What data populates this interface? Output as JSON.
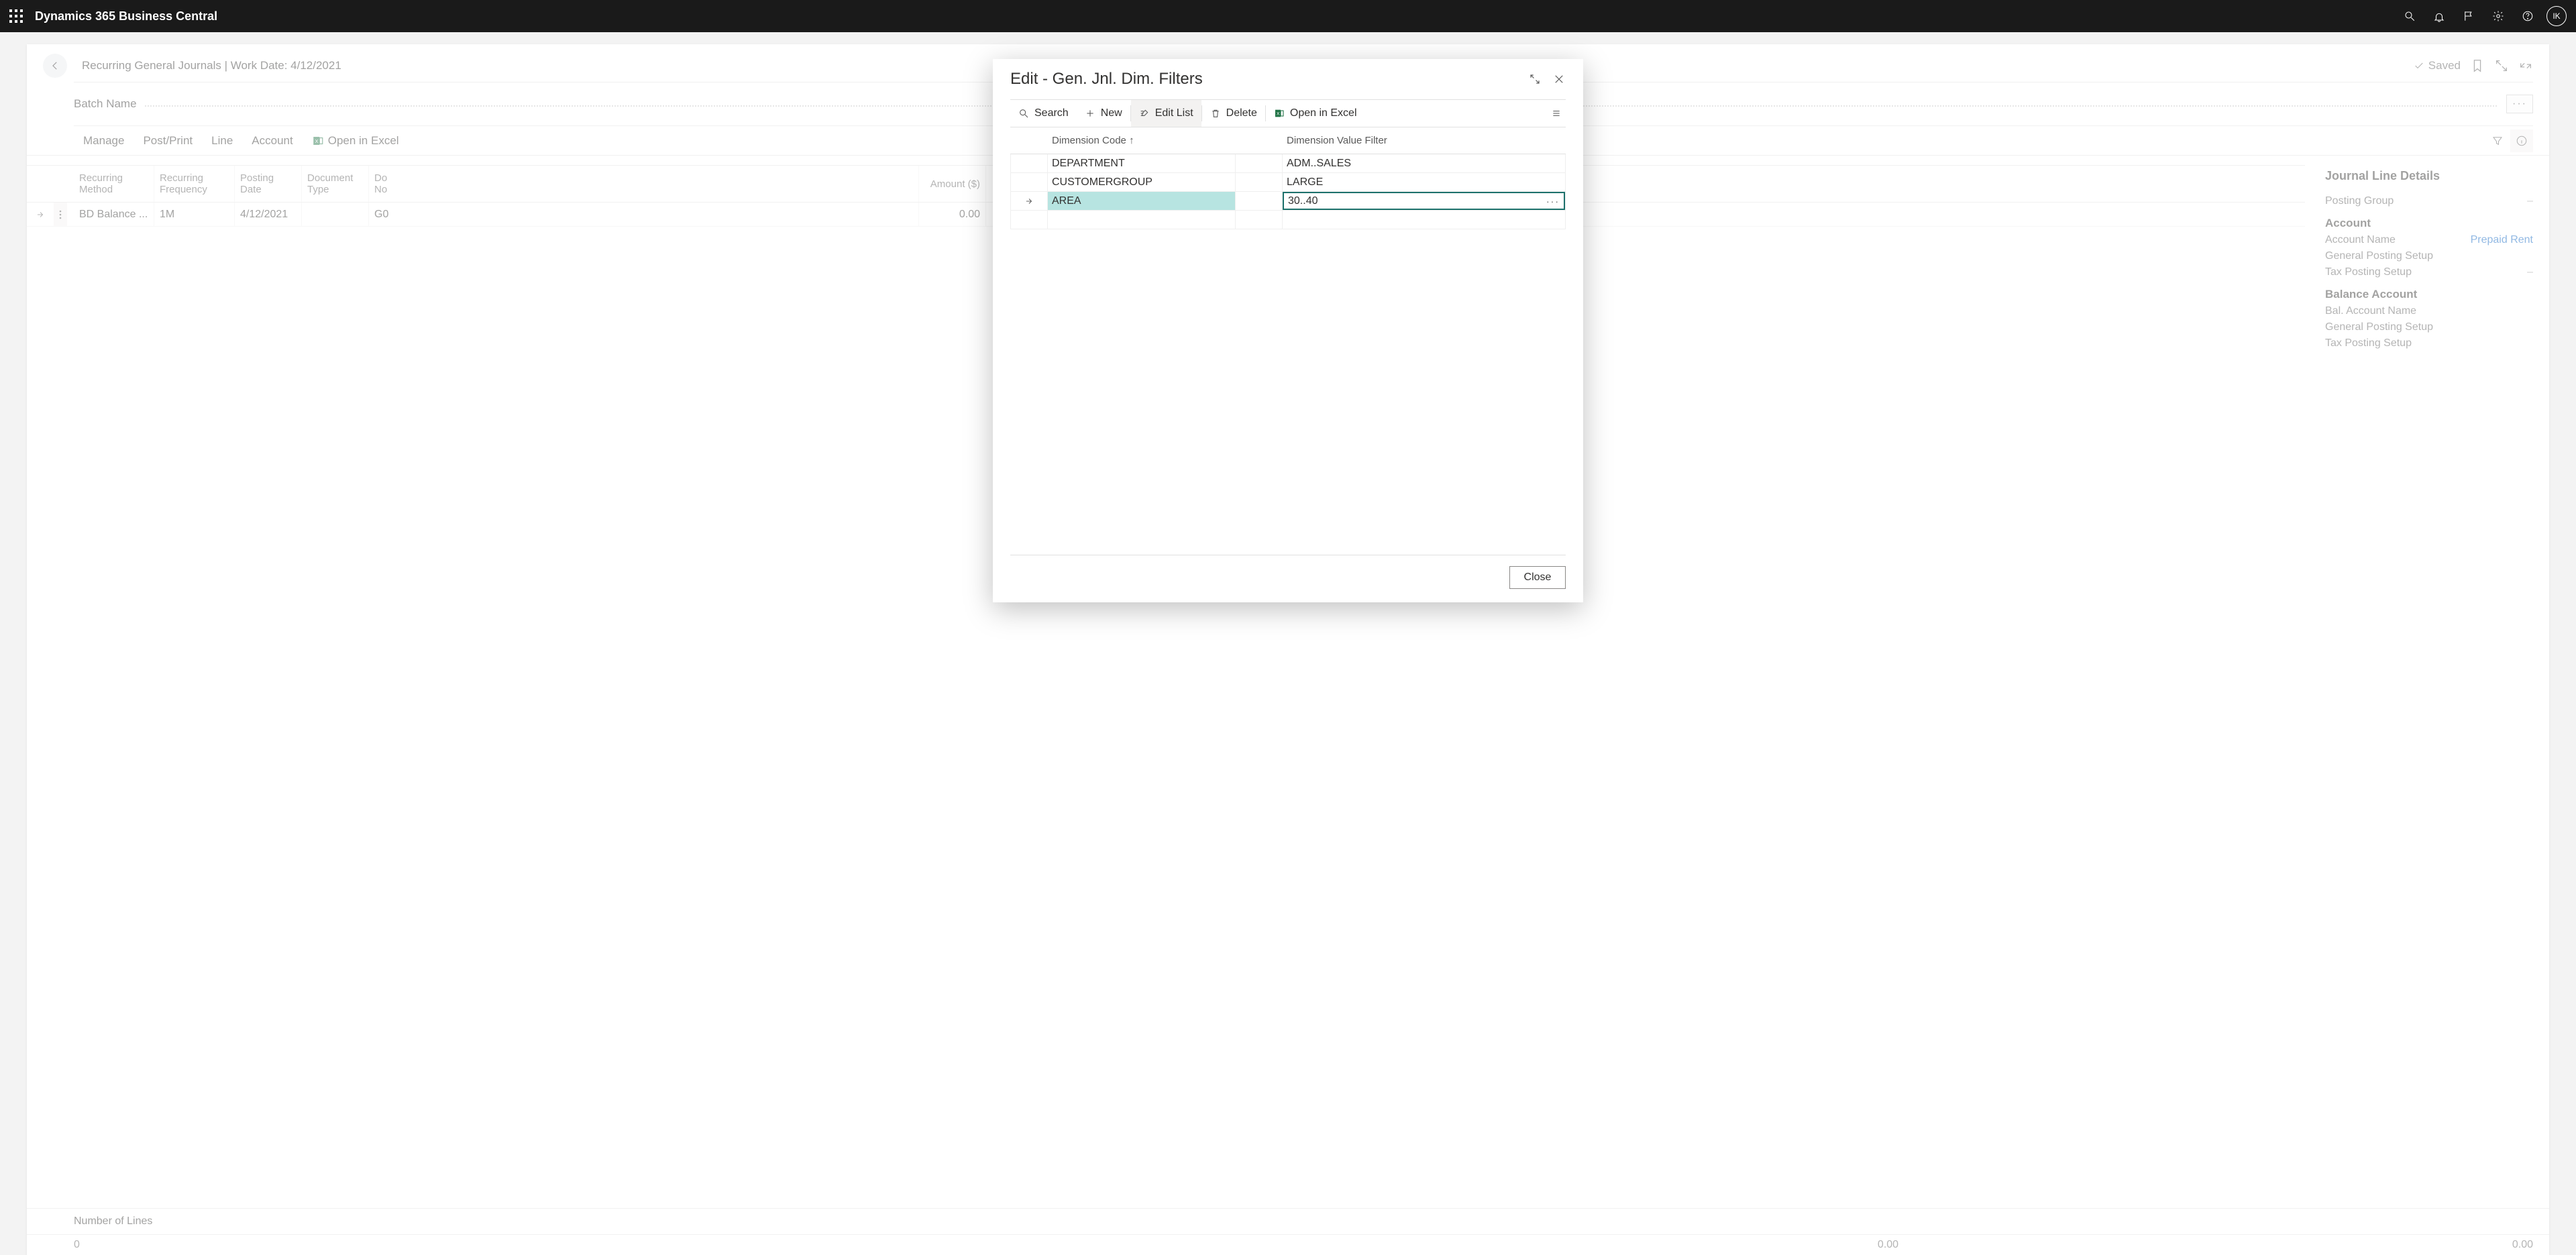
{
  "appbar": {
    "product": "Dynamics 365 Business Central",
    "avatar_initials": "IK"
  },
  "page": {
    "breadcrumb": "Recurring General Journals | Work Date: 4/12/2021",
    "saved_label": "Saved",
    "batch_label": "Batch Name",
    "commands": {
      "manage": "Manage",
      "post_print": "Post/Print",
      "line": "Line",
      "account": "Account",
      "open_excel": "Open in Excel"
    },
    "grid": {
      "cols": {
        "recurring_method": "Recurring Method",
        "recurring_frequency": "Recurring Frequency",
        "posting_date": "Posting Date",
        "document_type": "Document Type",
        "document_no_trunc": "Do\nNo",
        "amount": "Amount ($)"
      },
      "rows": [
        {
          "recurring_method": "BD Balance ...",
          "recurring_frequency": "1M",
          "posting_date": "4/12/2021",
          "document_type": "",
          "document_no": "G0",
          "amount": "0.00"
        }
      ]
    },
    "footer_label": "Number of Lines",
    "footer_values": {
      "v1": "0",
      "v2": "0.00",
      "v3": "0.00"
    }
  },
  "factbox": {
    "title": "Journal Line Details",
    "posting_group": "Posting Group",
    "sections": {
      "account": {
        "title": "Account",
        "account_name_lbl": "Account Name",
        "account_name_val": "Prepaid Rent",
        "general_posting_setup": "General Posting Setup",
        "tax_posting_setup": "Tax Posting Setup"
      },
      "balance": {
        "title": "Balance Account",
        "bal_account_name": "Bal. Account Name",
        "general_posting_setup": "General Posting Setup",
        "tax_posting_setup": "Tax Posting Setup"
      }
    }
  },
  "modal": {
    "title": "Edit - Gen. Jnl. Dim. Filters",
    "commands": {
      "search": "Search",
      "new": "New",
      "edit_list": "Edit List",
      "delete": "Delete",
      "open_excel": "Open in Excel"
    },
    "close_label": "Close",
    "columns": {
      "dimension_code": "Dimension Code",
      "dimension_value_filter": "Dimension Value Filter"
    },
    "rows": [
      {
        "code": "DEPARTMENT",
        "filter": "ADM..SALES",
        "selected": false
      },
      {
        "code": "CUSTOMERGROUP",
        "filter": "LARGE",
        "selected": false
      },
      {
        "code": "AREA",
        "filter": "30..40",
        "selected": true
      }
    ]
  }
}
